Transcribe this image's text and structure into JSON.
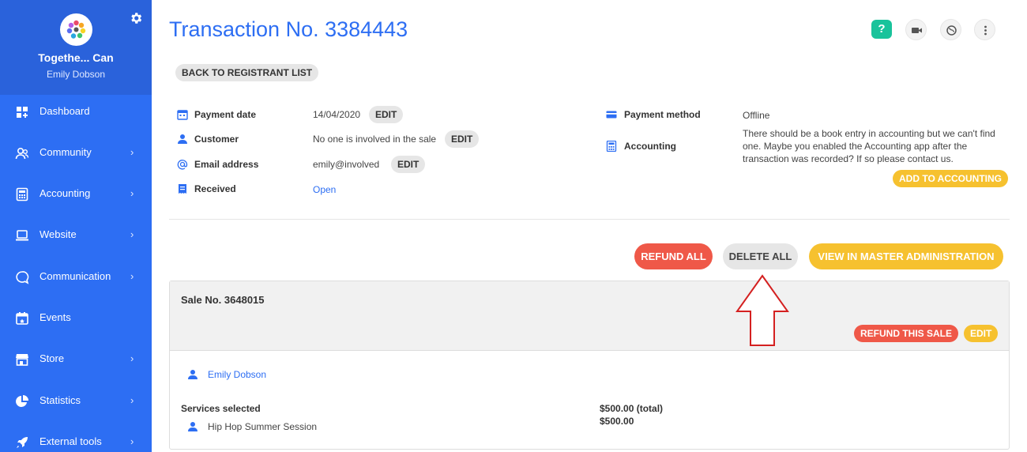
{
  "sidebar": {
    "org_name": "Togethe... Can",
    "user_name": "Emily Dobson",
    "items": [
      {
        "label": "Dashboard",
        "icon": "dashboard-icon",
        "chevron": false
      },
      {
        "label": "Community",
        "icon": "community-icon",
        "chevron": true
      },
      {
        "label": "Accounting",
        "icon": "calculator-icon",
        "chevron": true
      },
      {
        "label": "Website",
        "icon": "laptop-icon",
        "chevron": true
      },
      {
        "label": "Communication",
        "icon": "chat-icon",
        "chevron": true
      },
      {
        "label": "Events",
        "icon": "calendar-icon",
        "chevron": false
      },
      {
        "label": "Store",
        "icon": "store-icon",
        "chevron": true
      },
      {
        "label": "Statistics",
        "icon": "pie-chart-icon",
        "chevron": true
      },
      {
        "label": "External tools",
        "icon": "rocket-icon",
        "chevron": true
      }
    ]
  },
  "header": {
    "title": "Transaction No. 3384443",
    "help_label": "?"
  },
  "back_label": "BACK TO REGISTRANT LIST",
  "details": {
    "payment_date": {
      "label": "Payment date",
      "value": "14/04/2020",
      "edit": "EDIT"
    },
    "customer": {
      "label": "Customer",
      "value": "No one is involved in the sale",
      "edit": "EDIT"
    },
    "email": {
      "label": "Email address",
      "value": "emily@involved",
      "edit": "EDIT"
    },
    "received": {
      "label": "Received",
      "value": "Open"
    },
    "payment_method": {
      "label": "Payment method",
      "value": "Offline"
    },
    "accounting": {
      "label": "Accounting",
      "value": "There should be a book entry in accounting but we can't find one. Maybe you enabled the Accounting app after the transaction was recorded? If so please contact us.",
      "button": "ADD TO ACCOUNTING"
    }
  },
  "actions": {
    "refund_all": "REFUND ALL",
    "delete_all": "DELETE ALL",
    "view_master": "VIEW IN MASTER ADMINISTRATION"
  },
  "sale": {
    "title": "Sale No. 3648015",
    "refund_label": "REFUND THIS SALE",
    "edit_label": "EDIT",
    "customer_name": "Emily Dobson",
    "services_label": "Services selected",
    "service_name": "Hip Hop Summer Session",
    "total": "$500.00 (total)",
    "amount": "$500.00"
  },
  "colors": {
    "sidebar": "#2d6ef3",
    "accent": "#2d6ef3",
    "yellow": "#f6c12f",
    "red": "#ef5848",
    "help": "#19c39b",
    "arrow": "#d42020"
  }
}
